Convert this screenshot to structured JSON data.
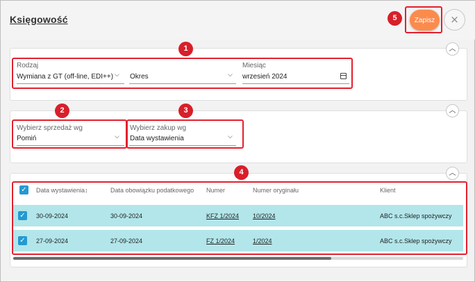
{
  "header": {
    "title": "Księgowość",
    "save_label": "Zapisz",
    "close_icon": "×"
  },
  "badges": [
    "1",
    "2",
    "3",
    "4",
    "5"
  ],
  "section1": {
    "rodzaj_label": "Rodzaj",
    "rodzaj_value": "Wymiana z GT (off-line, EDI++)",
    "okres_value": "Okres",
    "miesiac_label": "Miesiąc",
    "miesiac_value": "wrzesień 2024"
  },
  "section2": {
    "sprzedaz_label": "Wybierz sprzedaż wg",
    "sprzedaz_value": "Pomiń",
    "zakup_label": "Wybierz zakup wg",
    "zakup_value": "Data wystawienia"
  },
  "table": {
    "columns": [
      "Data wystawienia↕",
      "Data obowiązku podatkowego",
      "Numer",
      "Numer oryginału",
      "Klient"
    ],
    "rows": [
      [
        "30-09-2024",
        "30-09-2024",
        "KFZ 1/2024",
        "10/2024",
        "ABC s.c.Sklep spożywczy"
      ],
      [
        "27-09-2024",
        "27-09-2024",
        "FZ 1/2024",
        "1/2024",
        "ABC s.c.Sklep spożywczy"
      ]
    ]
  },
  "icons": {
    "collapse": "chevron-up-icon",
    "dropdown": "chevron-down-icon",
    "calendar": "calendar-icon",
    "checkbox": "checkmark-icon"
  },
  "colors": {
    "accent": "#fb8b4d",
    "selected_row": "#b2e6ea",
    "checkbox": "#239ad2",
    "annotation": "#e3202e"
  }
}
